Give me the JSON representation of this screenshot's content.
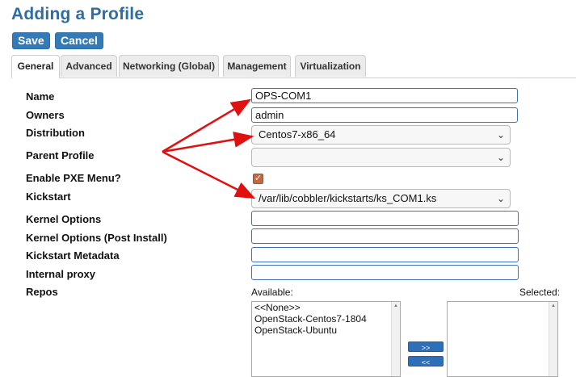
{
  "page": {
    "title": "Adding a Profile"
  },
  "toolbar": {
    "save_label": "Save",
    "cancel_label": "Cancel"
  },
  "tabs": [
    {
      "label": "General",
      "active": true
    },
    {
      "label": "Advanced"
    },
    {
      "label": "Networking (Global)"
    },
    {
      "label": "Management"
    },
    {
      "label": "Virtualization"
    }
  ],
  "form": {
    "name": {
      "label": "Name",
      "value": "OPS-COM1"
    },
    "owners": {
      "label": "Owners",
      "value": "admin"
    },
    "distribution": {
      "label": "Distribution",
      "value": "Centos7-x86_64"
    },
    "parent_profile": {
      "label": "Parent Profile",
      "value": ""
    },
    "enable_pxe": {
      "label": "Enable PXE Menu?",
      "checked": true
    },
    "kickstart": {
      "label": "Kickstart",
      "value": "/var/lib/cobbler/kickstarts/ks_COM1.ks"
    },
    "kernel_options": {
      "label": "Kernel Options",
      "value": ""
    },
    "kernel_options_post": {
      "label": "Kernel Options (Post Install)",
      "value": ""
    },
    "kickstart_metadata": {
      "label": "Kickstart Metadata",
      "value": ""
    },
    "internal_proxy": {
      "label": "Internal proxy",
      "value": ""
    },
    "repos": {
      "label": "Repos",
      "available_label": "Available:",
      "selected_label": "Selected:",
      "available": [
        "<<None>>",
        "OpenStack-Centos7-1804",
        "OpenStack-Ubuntu"
      ],
      "add_label": ">>",
      "remove_label": "<<"
    }
  },
  "colors": {
    "title": "#2e6da4",
    "button": "#337ab7",
    "annotation_arrow": "#e01010",
    "checkbox": "#c46a42"
  }
}
